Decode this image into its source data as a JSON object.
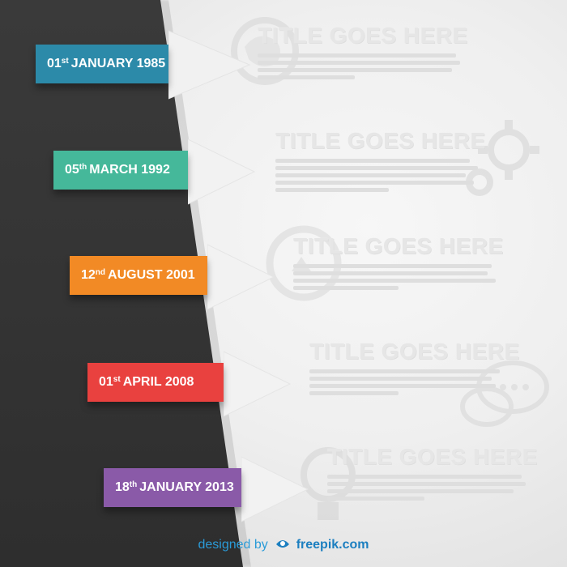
{
  "dates": [
    {
      "day": "01",
      "suffix": "st",
      "rest": "JANUARY 1985",
      "color": "#2c8aa9"
    },
    {
      "day": "05",
      "suffix": "th",
      "rest": "MARCH 1992",
      "color": "#45b89a"
    },
    {
      "day": "12",
      "suffix": "nd",
      "rest": "AUGUST 2001",
      "color": "#f28a25"
    },
    {
      "day": "01",
      "suffix": "st",
      "rest": "APRIL 2008",
      "color": "#e9413f"
    },
    {
      "day": "18",
      "suffix": "th",
      "rest": "JANUARY 2013",
      "color": "#8a5aa8"
    }
  ],
  "entries": [
    {
      "title": "TITLE GOES HERE"
    },
    {
      "title": "TITLE GOES HERE"
    },
    {
      "title": "TITLE GOES HERE"
    },
    {
      "title": "TITLE GOES HERE"
    },
    {
      "title": "TITLE GOES HERE"
    }
  ],
  "credit": {
    "designed": "designed by",
    "brand": "freepik.com"
  },
  "icons": [
    "globe-icon",
    "gear-icon",
    "magnifier-icon",
    "chat-icon",
    "lightbulb-icon",
    "freepik-logo-icon"
  ]
}
